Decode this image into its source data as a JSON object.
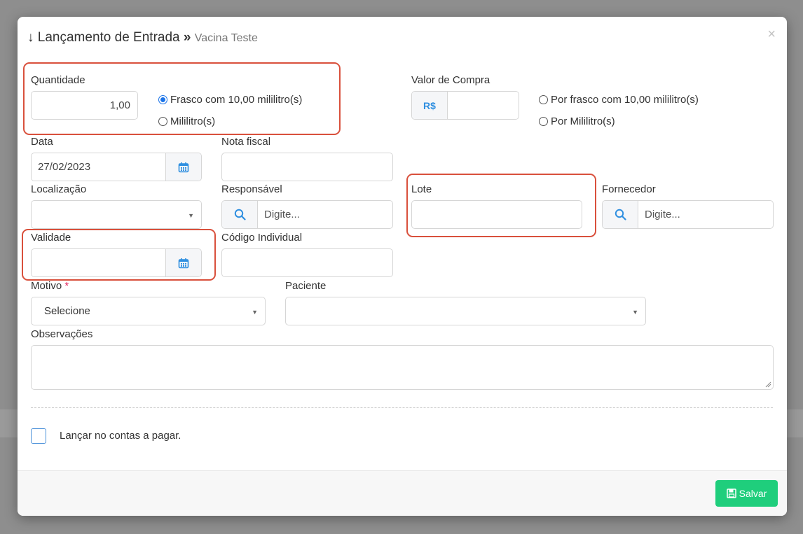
{
  "modal": {
    "title_icon": "↓",
    "title": "Lançamento de Entrada",
    "separator": "»",
    "subtitle": "Vacina Teste",
    "close_label": "×"
  },
  "quantidade": {
    "label": "Quantidade",
    "value": "1,00",
    "option_frasco": "Frasco com 10,00 mililitro(s)",
    "option_mililitro": "Mililitro(s)",
    "selected": "frasco"
  },
  "valor_compra": {
    "label": "Valor de Compra",
    "currency": "R$",
    "value": "",
    "option_frasco": "Por frasco com 10,00 mililitro(s)",
    "option_mililitro": "Por Mililitro(s)"
  },
  "data": {
    "label": "Data",
    "value": "27/02/2023"
  },
  "nota_fiscal": {
    "label": "Nota fiscal",
    "value": ""
  },
  "localizacao": {
    "label": "Localização",
    "value": ""
  },
  "responsavel": {
    "label": "Responsável",
    "placeholder": "Digite..."
  },
  "lote": {
    "label": "Lote",
    "value": ""
  },
  "fornecedor": {
    "label": "Fornecedor",
    "placeholder": "Digite..."
  },
  "validade": {
    "label": "Validade",
    "value": ""
  },
  "codigo_individual": {
    "label": "Código Individual",
    "value": ""
  },
  "motivo": {
    "label": "Motivo",
    "required_mark": "*",
    "value": "Selecione"
  },
  "paciente": {
    "label": "Paciente",
    "value": ""
  },
  "observacoes": {
    "label": "Observações",
    "value": ""
  },
  "contas": {
    "label": "Lançar no contas a pagar.",
    "checked": false
  },
  "footer": {
    "save_label": "Salvar"
  },
  "colors": {
    "accent": "#1a73e8",
    "addon_text": "#2f8fe0",
    "highlight": "#d9503c",
    "save_button": "#1fce7c",
    "required": "#e0245e"
  }
}
